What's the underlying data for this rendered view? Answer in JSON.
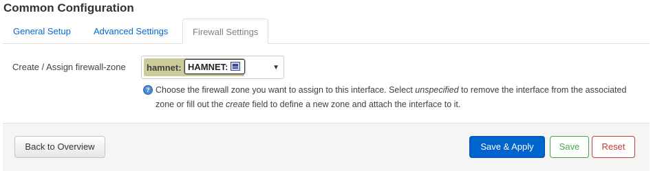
{
  "page": {
    "title": "Common Configuration"
  },
  "tabs": [
    {
      "label": "General Setup",
      "active": false
    },
    {
      "label": "Advanced Settings",
      "active": false
    },
    {
      "label": "Firewall Settings",
      "active": true
    }
  ],
  "firewall_zone": {
    "label": "Create / Assign firewall-zone",
    "zone_name": "hamnet:",
    "interface_name": "HAMNET:",
    "interface_icon": "network-interface-icon",
    "zone_color": "#cccc99",
    "help_parts": [
      "Choose the firewall zone you want to assign to this interface. Select ",
      "unspecified",
      " to remove the interface from the associated zone or fill out the ",
      "create",
      " field to define a new zone and attach the interface to it."
    ]
  },
  "footer": {
    "back_label": "Back to Overview",
    "save_apply_label": "Save & Apply",
    "save_label": "Save",
    "reset_label": "Reset"
  },
  "colors": {
    "link": "#0069d6",
    "primary": "#0064cd",
    "success": "#46a546",
    "danger": "#c43c35"
  }
}
